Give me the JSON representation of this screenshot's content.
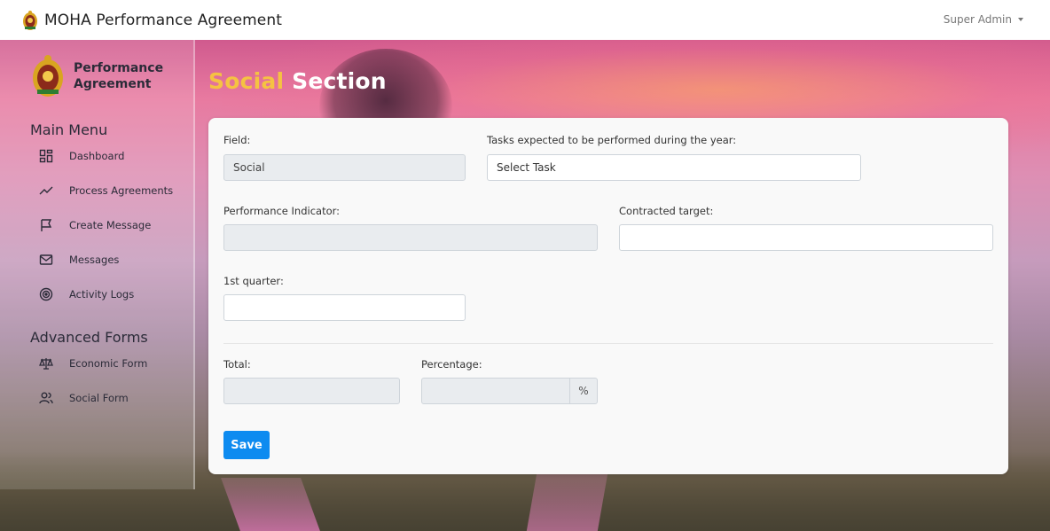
{
  "app": {
    "title": "MOHA Performance Agreement",
    "user": "Super Admin"
  },
  "sidebar": {
    "brand_line1": "Performance",
    "brand_line2": "Agreement",
    "main_heading": "Main Menu",
    "main_items": [
      {
        "label": "Dashboard",
        "icon": "dashboard-icon"
      },
      {
        "label": "Process Agreements",
        "icon": "trend-line-icon"
      },
      {
        "label": "Create Message",
        "icon": "flag-icon"
      },
      {
        "label": "Messages",
        "icon": "mail-icon"
      },
      {
        "label": "Activity Logs",
        "icon": "target-icon"
      }
    ],
    "advanced_heading": "Advanced Forms",
    "advanced_items": [
      {
        "label": "Economic Form",
        "icon": "scale-icon"
      },
      {
        "label": "Social Form",
        "icon": "users-icon"
      }
    ]
  },
  "page": {
    "title_highlight": "Social",
    "title_rest": " Section"
  },
  "form": {
    "field_label": "Field:",
    "field_value": "Social",
    "tasks_label": "Tasks expected to be performed during the year:",
    "tasks_value": "Select Task",
    "indicator_label": "Performance Indicator:",
    "indicator_value": "",
    "target_label": "Contracted target:",
    "target_value": "",
    "quarter_label": "1st quarter:",
    "quarter_value": "",
    "total_label": "Total:",
    "total_value": "",
    "percentage_label": "Percentage:",
    "percentage_value": "",
    "percentage_addon": "%",
    "save_label": "Save"
  },
  "colors": {
    "accent": "#0d8bf0",
    "title_highlight": "#f5c242"
  }
}
